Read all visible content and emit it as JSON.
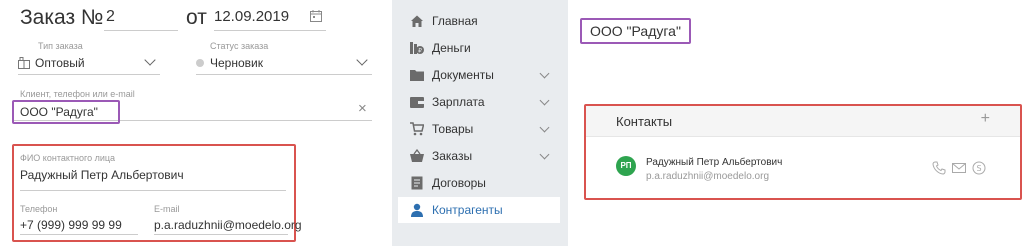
{
  "order": {
    "title": "Заказ №",
    "number": "2",
    "date_prefix": "от",
    "date": "12.09.2019",
    "type_label": "Тип заказа",
    "type_value": "Оптовый",
    "status_label": "Статус заказа",
    "status_value": "Черновик",
    "client_label": "Клиент, телефон или e-mail",
    "client_value": "ООО \"Радуга\"",
    "clear_symbol": "×"
  },
  "contact": {
    "fio_label": "ФИО контактного лица",
    "fio_value": "Радужный Петр Альбертович",
    "phone_label": "Телефон",
    "phone_value": "+7 (999) 999 99 99",
    "email_label": "E-mail",
    "email_value": "p.a.raduzhnii@moedelo.org"
  },
  "sidebar": {
    "items": [
      {
        "label": "Главная",
        "icon": "home-icon",
        "chevron": false,
        "active": false
      },
      {
        "label": "Деньги",
        "icon": "money-icon",
        "chevron": false,
        "active": false
      },
      {
        "label": "Документы",
        "icon": "folder-icon",
        "chevron": true,
        "active": false
      },
      {
        "label": "Зарплата",
        "icon": "wallet-icon",
        "chevron": true,
        "active": false
      },
      {
        "label": "Товары",
        "icon": "cart-icon",
        "chevron": true,
        "active": false
      },
      {
        "label": "Заказы",
        "icon": "basket-icon",
        "chevron": true,
        "active": false
      },
      {
        "label": "Договоры",
        "icon": "document-icon",
        "chevron": false,
        "active": false
      },
      {
        "label": "Контрагенты",
        "icon": "person-icon",
        "chevron": false,
        "active": true
      }
    ]
  },
  "right": {
    "org_title": "ООО \"Радуга\"",
    "contacts_title": "Контакты",
    "add_symbol": "+",
    "avatar_initials": "РП",
    "contact_name": "Радужный Петр Альбертович",
    "contact_email": "p.a.raduzhnii@moedelo.org"
  },
  "colors": {
    "highlight_purple": "#9b59b6",
    "highlight_red": "#d9534f",
    "active_blue": "#2d6fb0",
    "avatar_green": "#2ea44f"
  }
}
